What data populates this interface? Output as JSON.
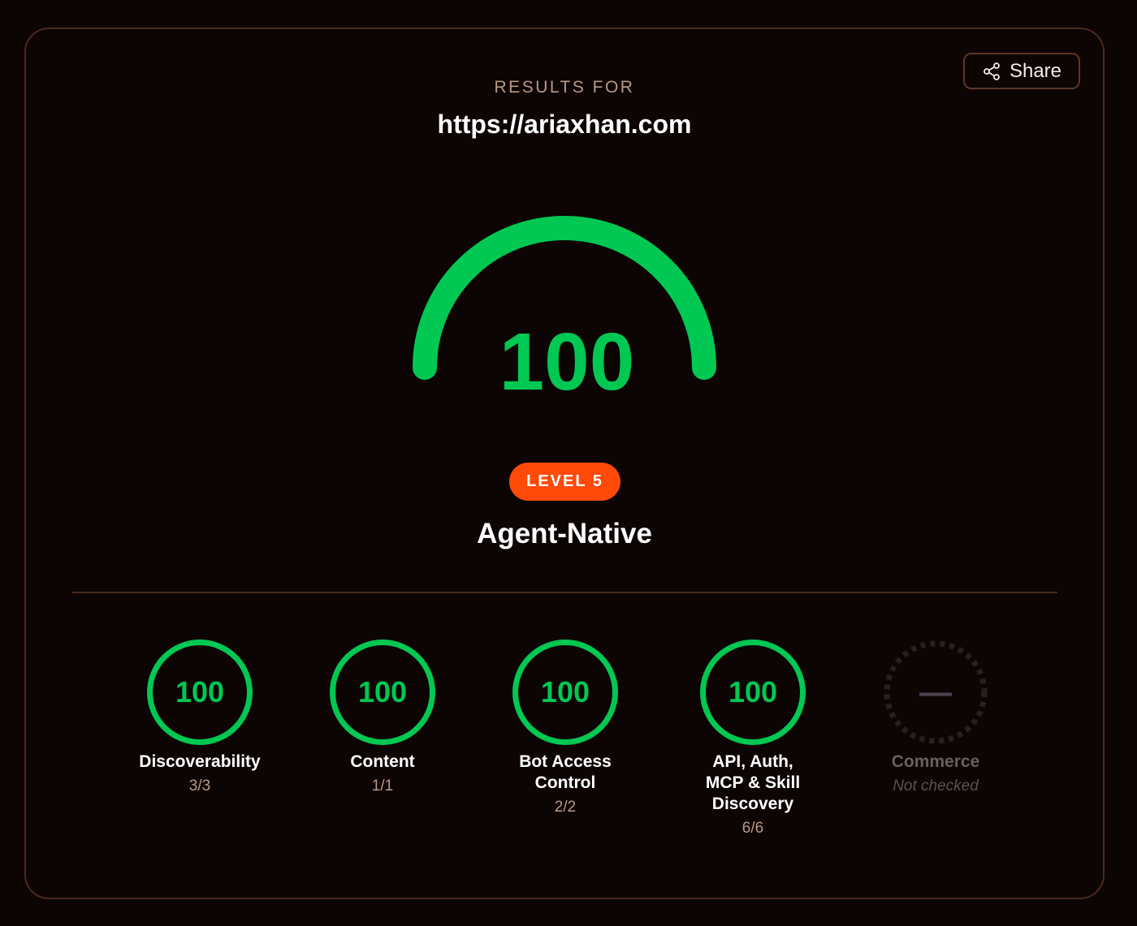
{
  "header": {
    "results_for": "RESULTS FOR",
    "url": "https://ariaxhan.com",
    "share_label": "Share",
    "share_icon": "share-icon"
  },
  "score": {
    "value": "100",
    "gauge_fill_fraction": 1.0,
    "color": "#00c853"
  },
  "level": {
    "badge": "LEVEL 5",
    "badge_color": "#ff4a0a",
    "name": "Agent-Native"
  },
  "categories": [
    {
      "score": "100",
      "label": "Discoverability",
      "sub": "3/3"
    },
    {
      "score": "100",
      "label": "Content",
      "sub": "1/1"
    },
    {
      "score": "100",
      "label": "Bot Access Control",
      "sub": "2/2"
    },
    {
      "score": "100",
      "label": "API, Auth, MCP & Skill Discovery",
      "sub": "6/6"
    },
    {
      "score": "—",
      "label": "Commerce",
      "sub": "Not checked"
    }
  ],
  "colors": {
    "background": "#0d0404",
    "border": "#4a2a1c",
    "accent_green": "#00c853",
    "muted_text": "#b89a86"
  }
}
